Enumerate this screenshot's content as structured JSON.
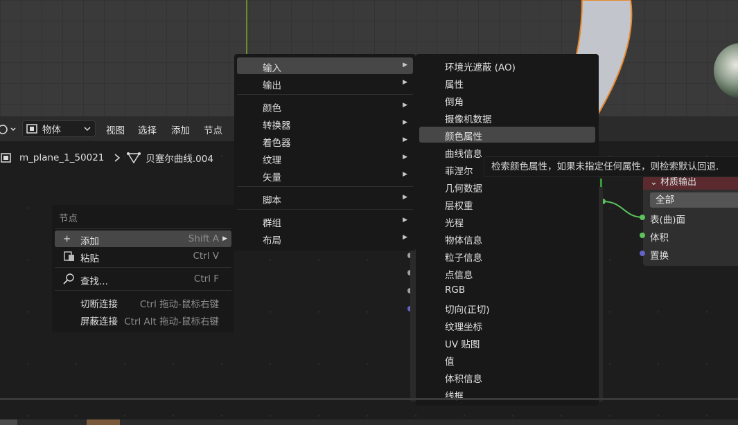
{
  "header": {
    "mode_select": "物体",
    "menus": [
      "视图",
      "选择",
      "添加",
      "节点"
    ]
  },
  "breadcrumb": {
    "object": "m_plane_1_50021",
    "data": "贝塞尔曲线.004"
  },
  "material_node": {
    "title": "材质输出",
    "target": "全部",
    "sockets": [
      "表(曲)面",
      "体积",
      "置换"
    ]
  },
  "context_menu": {
    "title": "节点",
    "items": [
      {
        "icon": "plus-icon",
        "label": "添加",
        "shortcut": "Shift A"
      },
      {
        "icon": "paste-icon",
        "label": "粘贴",
        "shortcut": "Ctrl V"
      },
      {
        "icon": "search-icon",
        "label": "查找...",
        "shortcut": "Ctrl F"
      },
      {
        "icon": "",
        "label": "切断连接",
        "shortcut": "Ctrl 拖动-鼠标右键"
      },
      {
        "icon": "",
        "label": "屏蔽连接",
        "shortcut": "Ctrl Alt 拖动-鼠标右键"
      }
    ]
  },
  "add_menu": {
    "items": [
      "输入",
      "输出",
      "颜色",
      "转换器",
      "着色器",
      "纹理",
      "矢量",
      "脚本",
      "群组",
      "布局"
    ]
  },
  "input_menu": {
    "items": [
      "环境光遮蔽 (AO)",
      "属性",
      "倒角",
      "摄像机数据",
      "颜色属性",
      "曲线信息",
      "菲涅尔",
      "几何数据",
      "层权重",
      "光程",
      "物体信息",
      "粒子信息",
      "点信息",
      "RGB",
      "切向(正切)",
      "纹理坐标",
      "UV 贴图",
      "值",
      "体积信息",
      "线框"
    ],
    "highlighted": "颜色属性"
  },
  "tooltip": "检索颜色属性，如果未指定任何属性，则检索默认回退."
}
